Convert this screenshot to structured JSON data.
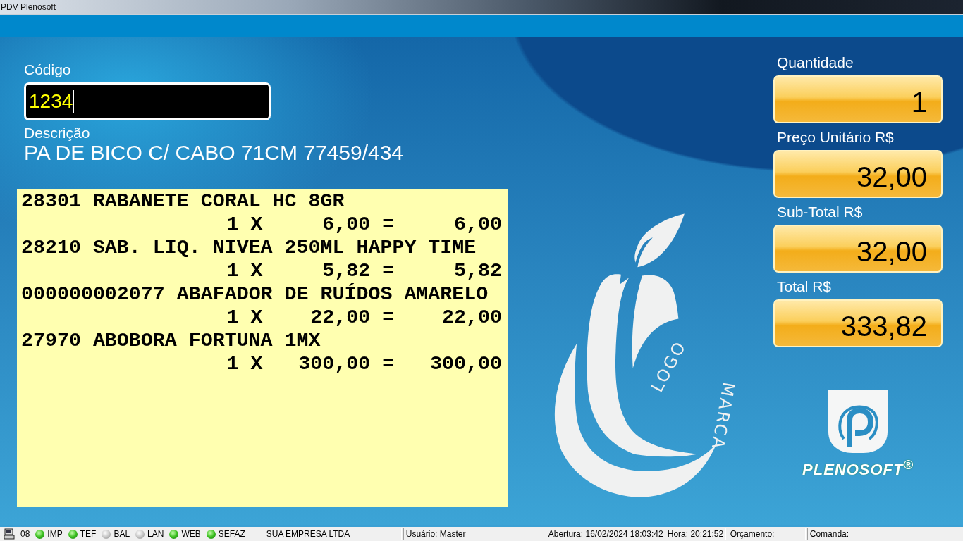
{
  "window": {
    "title": "PDV Plenosoft"
  },
  "code_field": {
    "label": "Código",
    "value": "1234"
  },
  "description": {
    "label": "Descrição",
    "value": "PA DE BICO C/ CABO 71CM 77459/434"
  },
  "receipt": [
    {
      "item": "28301 RABANETE CORAL HC 8GR",
      "detail": "1 X     6,00 =     6,00"
    },
    {
      "item": "28210 SAB. LIQ. NIVEA 250ML HAPPY TIME",
      "detail": "1 X     5,82 =     5,82"
    },
    {
      "item": "000000002077 ABAFADOR DE RUÍDOS AMARELO",
      "detail": "1 X    22,00 =    22,00"
    },
    {
      "item": "27970 ABOBORA FORTUNA 1MX",
      "detail": "1 X   300,00 =   300,00"
    }
  ],
  "logo": {
    "word_1": "LOGO",
    "word_2": "MARCA"
  },
  "totals": [
    {
      "label": "Quantidade",
      "value": "1"
    },
    {
      "label": "Preço Unitário R$",
      "value": "32,00"
    },
    {
      "label": "Sub-Total R$",
      "value": "32,00"
    },
    {
      "label": "Total R$",
      "value": "333,82"
    }
  ],
  "brand": {
    "name": "PLENOSOFT$^{®}$"
  },
  "status_bar": {
    "terminal": "08",
    "indicators": [
      {
        "label": "IMP",
        "on": true
      },
      {
        "label": "TEF",
        "on": true
      },
      {
        "label": "BAL",
        "on": false
      },
      {
        "label": "LAN",
        "on": false
      },
      {
        "label": "WEB",
        "on": true
      },
      {
        "label": "SEFAZ",
        "on": true
      }
    ],
    "panels": [
      "SUA EMPRESA LTDA",
      "Usuário: Master",
      "Abertura: 16/02/2024 18:03:42",
      "Hora: 20:21:52",
      "Orçamento:",
      "Comanda:"
    ]
  }
}
